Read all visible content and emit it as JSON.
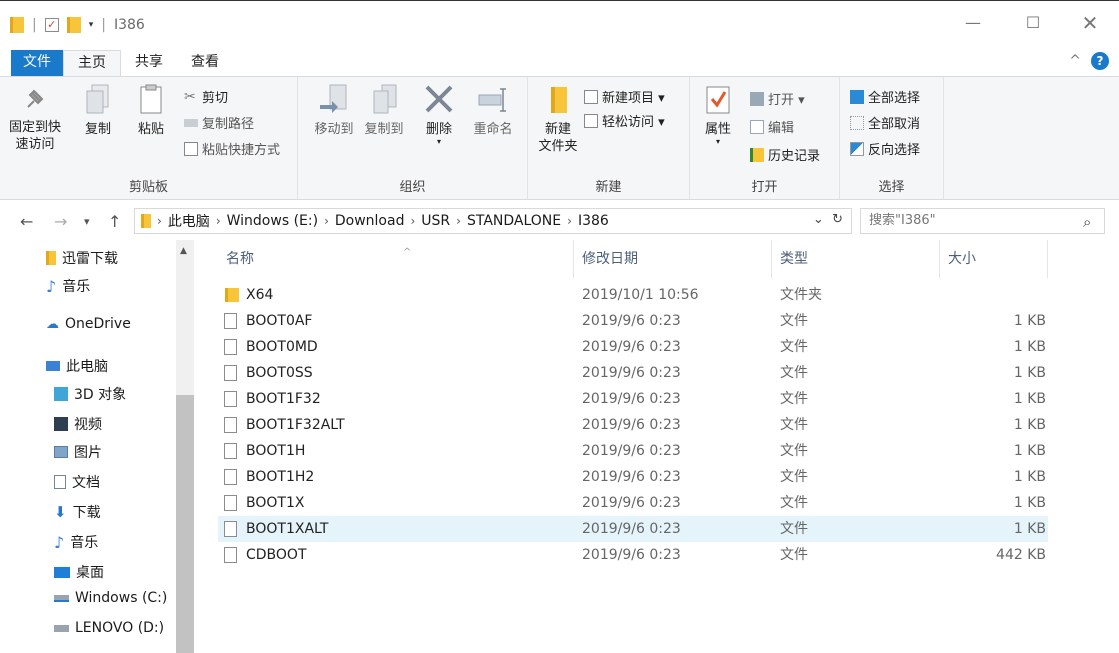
{
  "window": {
    "title": "I386",
    "minimize_glyph": "—",
    "maximize_glyph": "☐",
    "close_glyph": "✕"
  },
  "ribbon_tabs": [
    "文件",
    "主页",
    "共享",
    "查看"
  ],
  "ribbon": {
    "clipboard": {
      "pin_label_1": "固定到快",
      "pin_label_2": "速访问",
      "copy": "复制",
      "paste": "粘贴",
      "cut": "剪切",
      "copy_path": "复制路径",
      "paste_shortcut": "粘贴快捷方式",
      "group_label": "剪贴板"
    },
    "organize": {
      "move_to": "移动到",
      "copy_to": "复制到",
      "delete": "删除",
      "rename": "重命名",
      "group_label": "组织"
    },
    "new": {
      "new_folder_1": "新建",
      "new_folder_2": "文件夹",
      "new_item": "新建项目 ▾",
      "easy_access": "轻松访问 ▾",
      "group_label": "新建"
    },
    "open": {
      "properties": "属性",
      "open": "打开 ▾",
      "edit": "编辑",
      "history": "历史记录",
      "group_label": "打开"
    },
    "select": {
      "select_all": "全部选择",
      "select_none": "全部取消",
      "invert": "反向选择",
      "group_label": "选择"
    }
  },
  "address": {
    "crumbs": [
      "此电脑",
      "Windows (E:)",
      "Download",
      "USR",
      "STANDALONE",
      "I386"
    ],
    "search_placeholder": "搜索\"I386\""
  },
  "sidebar": [
    {
      "label": "迅雷下载",
      "icon": "folder-icon"
    },
    {
      "label": "音乐",
      "icon": "music-icon"
    },
    {
      "label": "OneDrive",
      "icon": "cloud-icon"
    },
    {
      "label": "此电脑",
      "icon": "computer-icon"
    },
    {
      "label": "3D 对象",
      "icon": "cube-icon"
    },
    {
      "label": "视频",
      "icon": "video-icon"
    },
    {
      "label": "图片",
      "icon": "picture-icon"
    },
    {
      "label": "文档",
      "icon": "document-icon"
    },
    {
      "label": "下载",
      "icon": "download-icon"
    },
    {
      "label": "音乐",
      "icon": "music-icon"
    },
    {
      "label": "桌面",
      "icon": "desktop-icon"
    },
    {
      "label": "Windows (C:)",
      "icon": "drive-icon"
    },
    {
      "label": "LENOVO (D:)",
      "icon": "drive-icon"
    }
  ],
  "columns": {
    "name": "名称",
    "date": "修改日期",
    "type": "类型",
    "size": "大小"
  },
  "files": [
    {
      "name": "X64",
      "date": "2019/10/1 10:56",
      "type": "文件夹",
      "size": "",
      "kind": "folder"
    },
    {
      "name": "BOOT0AF",
      "date": "2019/9/6 0:23",
      "type": "文件",
      "size": "1 KB",
      "kind": "file"
    },
    {
      "name": "BOOT0MD",
      "date": "2019/9/6 0:23",
      "type": "文件",
      "size": "1 KB",
      "kind": "file"
    },
    {
      "name": "BOOT0SS",
      "date": "2019/9/6 0:23",
      "type": "文件",
      "size": "1 KB",
      "kind": "file"
    },
    {
      "name": "BOOT1F32",
      "date": "2019/9/6 0:23",
      "type": "文件",
      "size": "1 KB",
      "kind": "file"
    },
    {
      "name": "BOOT1F32ALT",
      "date": "2019/9/6 0:23",
      "type": "文件",
      "size": "1 KB",
      "kind": "file"
    },
    {
      "name": "BOOT1H",
      "date": "2019/9/6 0:23",
      "type": "文件",
      "size": "1 KB",
      "kind": "file"
    },
    {
      "name": "BOOT1H2",
      "date": "2019/9/6 0:23",
      "type": "文件",
      "size": "1 KB",
      "kind": "file"
    },
    {
      "name": "BOOT1X",
      "date": "2019/9/6 0:23",
      "type": "文件",
      "size": "1 KB",
      "kind": "file"
    },
    {
      "name": "BOOT1XALT",
      "date": "2019/9/6 0:23",
      "type": "文件",
      "size": "1 KB",
      "kind": "file",
      "selected": true
    },
    {
      "name": "CDBOOT",
      "date": "2019/9/6 0:23",
      "type": "文件",
      "size": "442 KB",
      "kind": "file"
    }
  ],
  "colors": {
    "accent": "#1979ca",
    "selection": "#e5f3fb",
    "folder": "#f8c53a"
  }
}
